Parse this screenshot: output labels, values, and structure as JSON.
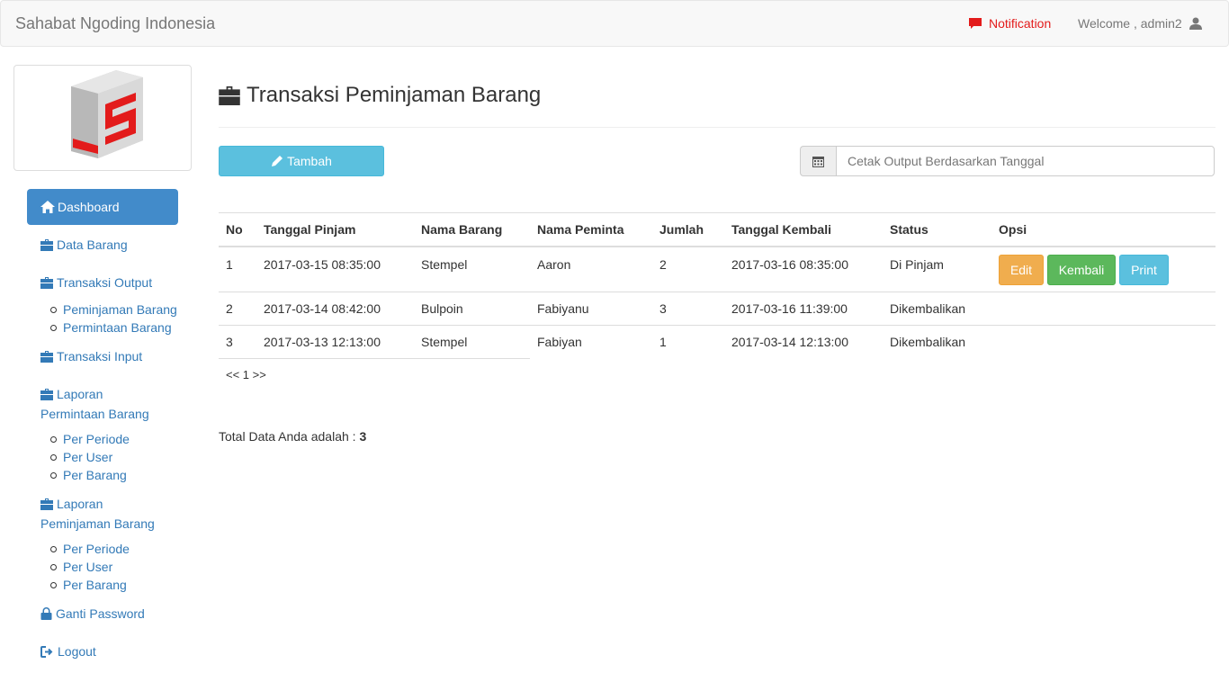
{
  "navbar": {
    "brand": "Sahabat Ngoding Indonesia",
    "notification": "Notification",
    "welcome": "Welcome , admin2"
  },
  "sidebar": {
    "dashboard": "Dashboard",
    "data_barang": "Data Barang",
    "transaksi_output": "Transaksi Output",
    "transaksi_output_sub": [
      "Peminjaman Barang",
      "Permintaan Barang"
    ],
    "transaksi_input": "Transaksi Input",
    "laporan_permintaan_line1": "Laporan",
    "laporan_permintaan_line2": "Permintaan Barang",
    "laporan_permintaan_sub": [
      "Per Periode",
      "Per User",
      "Per Barang"
    ],
    "laporan_peminjaman_line1": "Laporan",
    "laporan_peminjaman_line2": "Peminjaman Barang",
    "laporan_peminjaman_sub": [
      "Per Periode",
      "Per User",
      "Per Barang"
    ],
    "ganti_password": "Ganti Password",
    "logout": "Logout"
  },
  "main": {
    "title": "Transaksi Peminjaman Barang",
    "tambah_label": "Tambah",
    "date_placeholder": "Cetak Output Berdasarkan Tanggal",
    "table": {
      "headers": [
        "No",
        "Tanggal Pinjam",
        "Nama Barang",
        "Nama Peminta",
        "Jumlah",
        "Tanggal Kembali",
        "Status",
        "Opsi"
      ],
      "rows": [
        [
          "1",
          "2017-03-15 08:35:00",
          "Stempel",
          "Aaron",
          "2",
          "2017-03-16 08:35:00",
          "Di Pinjam"
        ],
        [
          "2",
          "2017-03-14 08:42:00",
          "Bulpoin",
          "Fabiyanu",
          "3",
          "2017-03-16 11:39:00",
          "Dikembalikan"
        ],
        [
          "3",
          "2017-03-13 12:13:00",
          "Stempel",
          "Fabiyan",
          "1",
          "2017-03-14 12:13:00",
          "Dikembalikan"
        ]
      ],
      "actions": {
        "edit": "Edit",
        "kembali": "Kembali",
        "print": "Print"
      }
    },
    "pager": "<< 1 >>",
    "total_label": "Total Data Anda adalah :",
    "total_value": "3"
  },
  "colors": {
    "primary": "#428bca",
    "link": "#337ab7",
    "info": "#5bc0de",
    "warning": "#f0ad4e",
    "success": "#5cb85c",
    "notification": "#e31b1b",
    "logo_red": "#e31b1b"
  },
  "icons": {
    "notification": "comment-icon",
    "user": "user-icon",
    "briefcase": "briefcase-icon",
    "home": "home-icon",
    "lock": "lock-icon",
    "logout": "logout-icon",
    "pencil": "pencil-icon",
    "calendar": "calendar-icon"
  }
}
